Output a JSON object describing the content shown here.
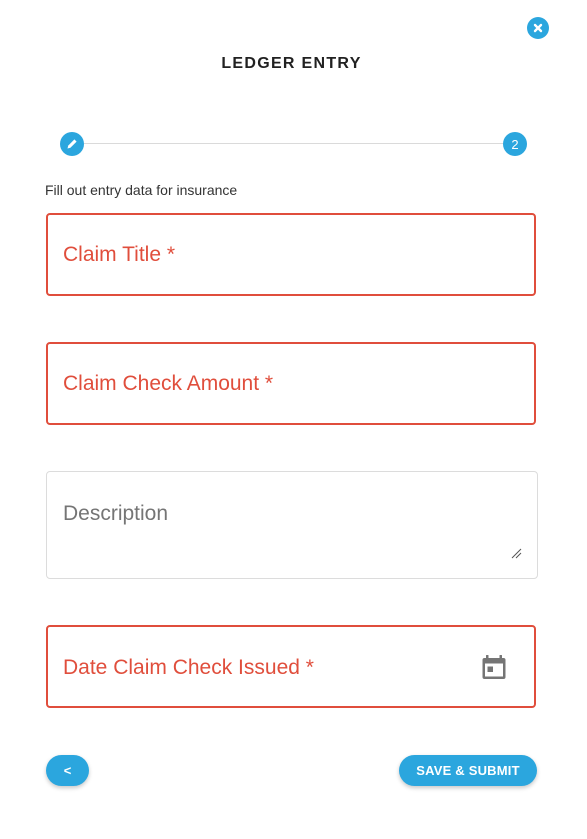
{
  "dialog": {
    "title": "LEDGER ENTRY",
    "close_icon": "close-circle-icon"
  },
  "stepper": {
    "step1_icon": "pencil-icon",
    "step2_label": "2",
    "accent_color": "#2ba6de"
  },
  "form": {
    "subtitle": "Fill out entry data for insurance",
    "fields": {
      "claim_title": {
        "label": "Claim Title *",
        "value": ""
      },
      "claim_check_amount": {
        "label": "Claim Check Amount *",
        "value": ""
      },
      "description": {
        "label": "Description",
        "value": ""
      },
      "date_claim_check_issued": {
        "label": "Date Claim Check Issued *",
        "value": "",
        "icon": "calendar-icon"
      }
    },
    "error_color": "#e04e3c"
  },
  "actions": {
    "back_label": "<",
    "submit_label": "SAVE & SUBMIT"
  }
}
